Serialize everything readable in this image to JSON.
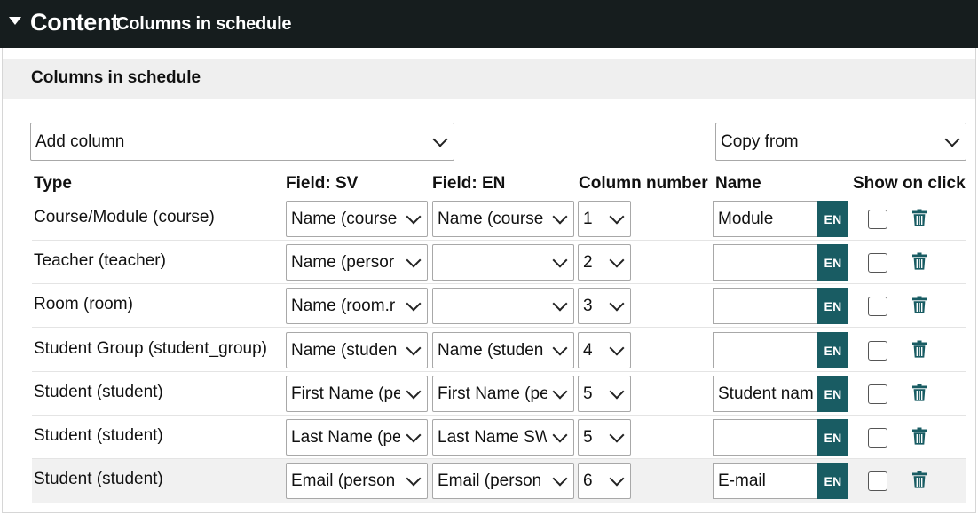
{
  "header": {
    "title": "Content",
    "subtitle": "Columns in schedule"
  },
  "panel": {
    "heading": "Columns in schedule"
  },
  "controls": {
    "add_column": "Add column",
    "copy_from": "Copy from"
  },
  "columns": {
    "type": "Type",
    "field_sv": "Field: SV",
    "field_en": "Field: EN",
    "column_number": "Column number",
    "name": "Name",
    "show_on_click": "Show on click"
  },
  "lang_button": "EN",
  "icons": {
    "collapse": "caret-down-icon",
    "dropdown": "chevron-down-icon",
    "delete": "trash-icon"
  },
  "colors": {
    "topbar": "#161d1e",
    "accent": "#195c63",
    "panel_header": "#efefef"
  },
  "rows": [
    {
      "type": "Course/Module (course)",
      "field_sv": "Name (course",
      "field_en": "Name (course",
      "number": "1",
      "name": "Module",
      "show_on_click": false
    },
    {
      "type": "Teacher (teacher)",
      "field_sv": "Name (persor",
      "field_en": "",
      "number": "2",
      "name": "",
      "show_on_click": false
    },
    {
      "type": "Room (room)",
      "field_sv": "Name (room.r",
      "field_en": "",
      "number": "3",
      "name": "",
      "show_on_click": false
    },
    {
      "type": "Student Group (student_group)",
      "field_sv": "Name (studen",
      "field_en": "Name (studen",
      "number": "4",
      "name": "",
      "show_on_click": false
    },
    {
      "type": "Student (student)",
      "field_sv": "First Name (pe",
      "field_en": "First Name (pe",
      "number": "5",
      "name": "Student nam",
      "show_on_click": false
    },
    {
      "type": "Student (student)",
      "field_sv": "Last Name (pe",
      "field_en": "Last Name SW",
      "number": "5",
      "name": "",
      "show_on_click": false
    },
    {
      "type": "Student (student)",
      "field_sv": "Email (person",
      "field_en": "Email (person",
      "number": "6",
      "name": "E-mail",
      "show_on_click": false
    }
  ]
}
